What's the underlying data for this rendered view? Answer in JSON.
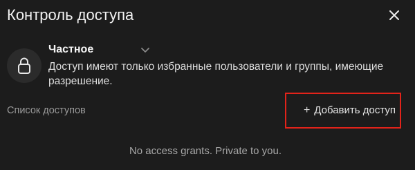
{
  "dialog": {
    "title": "Контроль доступа",
    "close_icon": "close-icon"
  },
  "access_level": {
    "icon": "lock-icon",
    "label": "Частное",
    "description": "Доступ имеют только избранные пользователи и группы, имеющие разрешение.",
    "dropdown_icon": "chevron-down-icon"
  },
  "access_list": {
    "title": "Список доступов",
    "add_icon": "plus-icon",
    "add_label": "Добавить доступ",
    "empty_message": "No access grants. Private to you."
  },
  "colors": {
    "background": "#1c1c1c",
    "highlight": "#e2231a",
    "muted_text": "#9a9a9a"
  }
}
